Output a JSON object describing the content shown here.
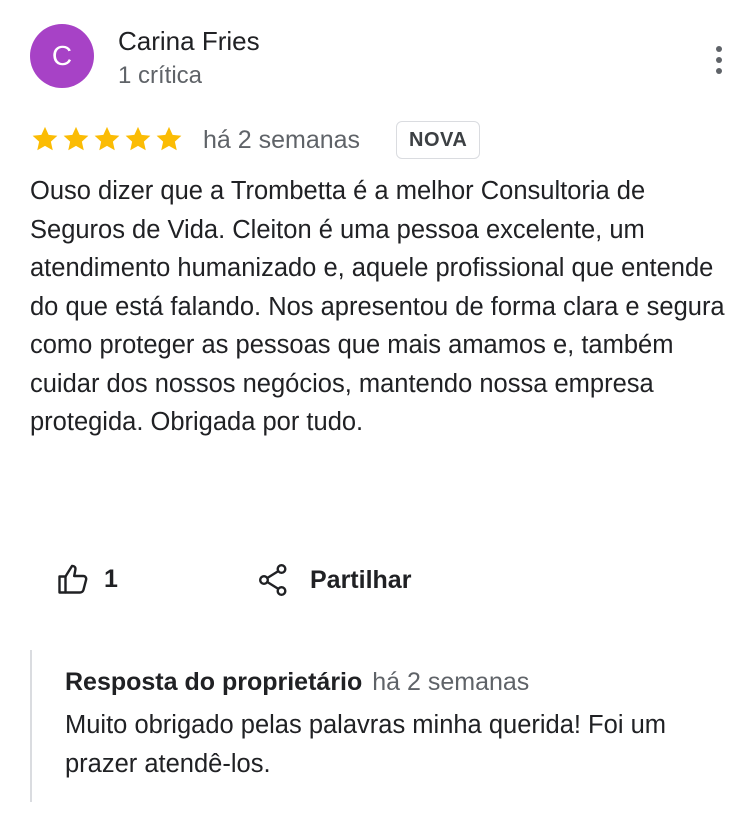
{
  "reviewer": {
    "initial": "C",
    "avatar_color": "#a742c6",
    "name": "Carina Fries",
    "review_count": "1 crítica"
  },
  "menu_icon": "more-vert-icon",
  "review": {
    "rating": 5,
    "max_rating": 5,
    "star_color": "#fbbc04",
    "date": "há 2 semanas",
    "badge": "NOVA",
    "text": "Ouso dizer que a Trombetta é a melhor Consultoria de Seguros de Vida. Cleiton é uma pessoa excelente, um atendimento humanizado e, aquele profissional que entende do que está falando. Nos apresentou de forma clara e segura como proteger as pessoas que mais amamos e, também cuidar dos nossos negócios, mantendo nossa empresa protegida. Obrigada por tudo."
  },
  "actions": {
    "like_icon": "thumb-up-icon",
    "like_count": "1",
    "share_icon": "share-icon",
    "share_label": "Partilhar"
  },
  "owner_reply": {
    "title": "Resposta do proprietário",
    "date": "há 2 semanas",
    "text": "Muito obrigado pelas palavras minha querida! Foi um prazer atendê-los."
  }
}
